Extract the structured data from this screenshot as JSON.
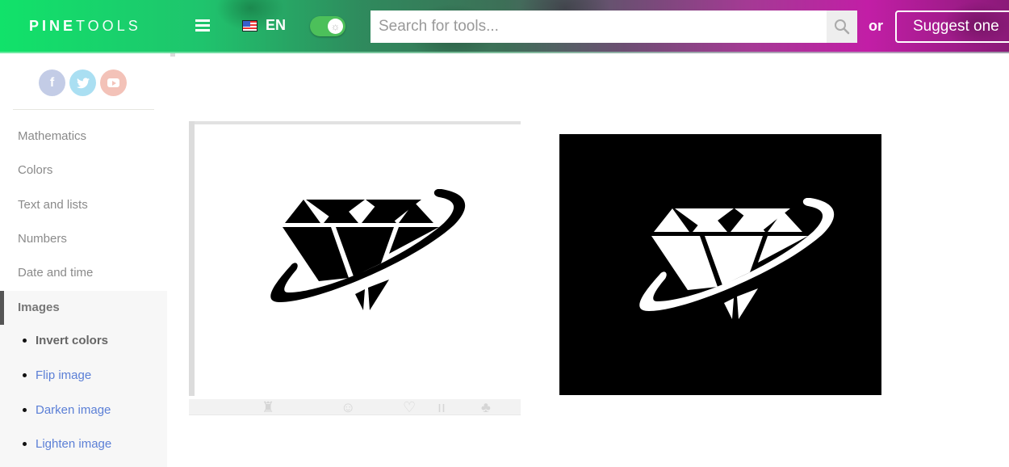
{
  "header": {
    "logo_bold": "PINE",
    "logo_light": "TOOLS",
    "menu_icon": "hamburger-menu-icon",
    "language_flag": "us-flag-icon",
    "language": "EN",
    "theme_toggle_icon": "sun-icon",
    "search": {
      "placeholder": "Search for tools...",
      "value": "",
      "icon": "search-icon"
    },
    "or_label": "or",
    "suggest_label": "Suggest one"
  },
  "sidebar": {
    "social": [
      {
        "name": "facebook",
        "glyph": "f"
      },
      {
        "name": "twitter",
        "glyph": "t"
      },
      {
        "name": "youtube",
        "glyph": ""
      }
    ],
    "categories": [
      {
        "label": "Mathematics"
      },
      {
        "label": "Colors"
      },
      {
        "label": "Text and lists"
      },
      {
        "label": "Numbers"
      },
      {
        "label": "Date and time"
      }
    ],
    "active_category": "Images",
    "subitems": [
      {
        "label": "Invert colors",
        "current": true
      },
      {
        "label": "Flip image",
        "current": false
      },
      {
        "label": "Darken image",
        "current": false
      },
      {
        "label": "Lighten image",
        "current": false
      }
    ]
  },
  "main": {
    "input_image": {
      "description": "Black diamond logo with orbit swoosh on white background"
    },
    "output_image": {
      "description": "Inverted: white diamond logo with orbit swoosh on black background"
    }
  },
  "colors": {
    "header_green": "#11e26a",
    "header_magenta": "#c21ea6",
    "link": "#5b7fd6",
    "toggle": "#4cc05a"
  }
}
